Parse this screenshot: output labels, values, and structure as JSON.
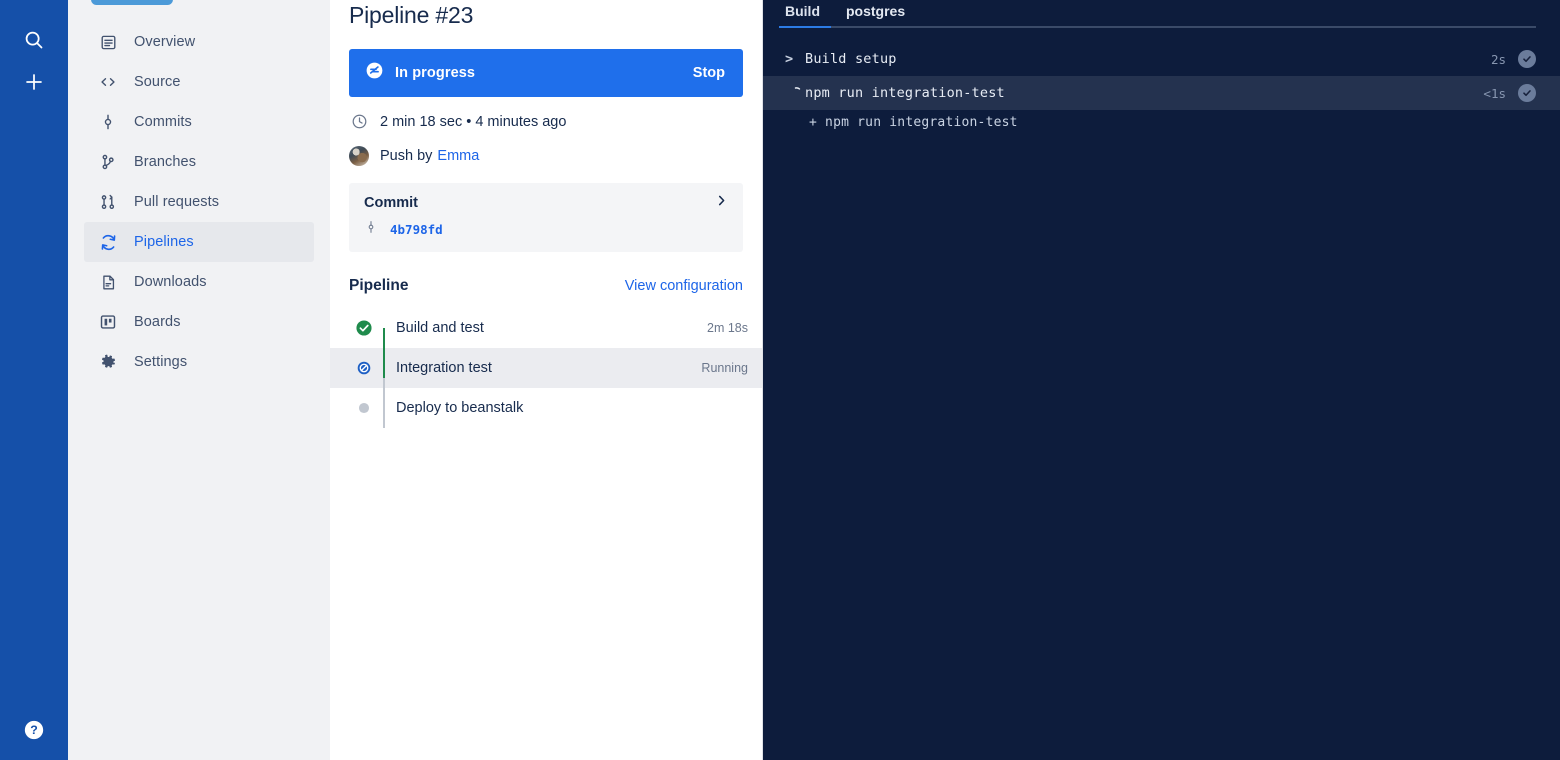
{
  "rail": {
    "search_icon": "search-icon",
    "create_icon": "plus-icon",
    "help_icon": "help-circle-icon",
    "brand_color": "#1550A9"
  },
  "nav": {
    "items": [
      {
        "label": "Overview",
        "icon": "overview-icon",
        "selected": false
      },
      {
        "label": "Source",
        "icon": "code-icon",
        "selected": false
      },
      {
        "label": "Commits",
        "icon": "commit-icon",
        "selected": false
      },
      {
        "label": "Branches",
        "icon": "branch-icon",
        "selected": false
      },
      {
        "label": "Pull requests",
        "icon": "pull-request-icon",
        "selected": false
      },
      {
        "label": "Pipelines",
        "icon": "pipelines-icon",
        "selected": true
      },
      {
        "label": "Downloads",
        "icon": "downloads-icon",
        "selected": false
      },
      {
        "label": "Boards",
        "icon": "boards-icon",
        "selected": false
      },
      {
        "label": "Settings",
        "icon": "gear-icon",
        "selected": false
      }
    ],
    "selected_color": "#1D65E8"
  },
  "detail": {
    "title": "Pipeline #23",
    "status": {
      "label": "In progress",
      "action_label": "Stop",
      "color": "#1F6FEB",
      "icon": "in-progress-icon"
    },
    "duration_line": "2 min 18 sec • 4 minutes ago",
    "duration_icon": "clock-icon",
    "author_prefix": "Push by",
    "author_name": "Emma",
    "commit_card": {
      "heading": "Commit",
      "chevron": "chevron-right-icon",
      "branch_icon": "commit-node-icon",
      "hash": "4b798fd"
    },
    "pipeline_section": {
      "heading": "Pipeline",
      "config_link": "View configuration"
    },
    "steps": [
      {
        "label": "Build and test",
        "meta": "2m 18s",
        "state": "success",
        "active": false,
        "icon": "check-circle-icon"
      },
      {
        "label": "Integration test",
        "meta": "Running",
        "state": "in-progress",
        "active": true,
        "icon": "in-progress-circle-icon"
      },
      {
        "label": "Deploy to beanstalk",
        "meta": "",
        "state": "pending",
        "active": false,
        "icon": "pending-dot-icon"
      }
    ],
    "colors": {
      "success": "#1F8B4C",
      "pending": "#C1C7D0",
      "link": "#1D65E8",
      "text": "#172B4D",
      "subtle": "#6B778C"
    }
  },
  "log": {
    "background": "#0D1C3C",
    "highlight": "#24324F",
    "tabs": [
      {
        "label": "Build",
        "active": true
      },
      {
        "label": "postgres",
        "active": false
      }
    ],
    "rows": [
      {
        "label": "Build setup",
        "leading": "caret",
        "caret": ">",
        "time": "2s",
        "badge": "check-badge-icon",
        "highlight": false
      },
      {
        "label": "npm run integration-test",
        "leading": "spinner",
        "caret": "",
        "time": "<1s",
        "badge": "check-badge-icon",
        "highlight": true
      }
    ],
    "output_lines": [
      "+ npm run integration-test"
    ]
  }
}
